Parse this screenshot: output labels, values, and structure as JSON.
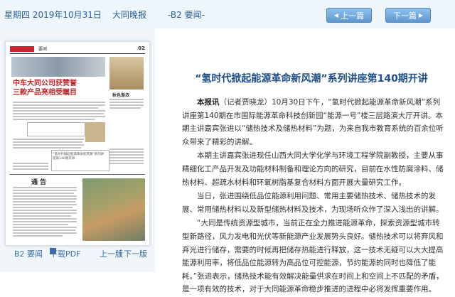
{
  "topbar": {
    "date": "星期四 2019年10月31日",
    "paper": "大同晚报",
    "page": "-B2 要闻-",
    "prev_label": "上一篇",
    "next_label": "下一篇"
  },
  "thumbnail": {
    "masthead_label": "要闻",
    "page_num": "02",
    "headline_line1": "中车大同公司获赞誉",
    "headline_line2": "三款产品亮相受瞩目",
    "notice_title": "通  告",
    "side_title": "秋色渐浓",
    "side_caption": "“氢时代掀起能源革命新风潮”系列讲座第140期开讲"
  },
  "bottom_links": {
    "page_label": "B2 要闻",
    "pdf_label": "下载PDF",
    "prev_page": "上一版",
    "separator": "|",
    "next_page": "下一版"
  },
  "article": {
    "title": "“氢时代掀起能源革命新风潮”系列讲座第140期开讲",
    "lead": "本报讯",
    "p1": "（记者贾晓龙）10月30日下午，“氢时代掀起能源革命新风潮”系列讲座第140期在市国际能源革命科技创新园“能源一号”楼三层路演大厅开讲。本期主讲嘉宾张进以“储热技术及储热材料”为题，为来自我市教育系统的百余位听众带来了精彩的讲解。",
    "p2": "本期主讲嘉宾张进现任山西大同大学化学与环境工程学院副教授，主要从事精细化工产品开发及功能材料制备和理论方向的研究，目前在水性防腐涂料、储热材料、超疏水材料和环氧树脂基复合材料方面开展大量研究工作。",
    "p3": "当日，张进围绕低品位能源利用问题、常用主要储热技术、储热技术的发展、常用储热材料以及新型储热材料及技术，为现场听众作了深入浅出的讲解。",
    "p4": "“大同是传统资源型城市，当前正在全力推进能源革命，探索资源型城市转型新路径，风力发电和光伏等新能源产业发展势头良好。储热技术可以将弃风和弃光进行储存，需要的时候再把储存热能进行释放，这一技术无疑可以大大提高能源利用率，将低品位能源转为高品位可控能源，节约能源的同时也降低了能耗。”张进表示，储热技术能有效解决能量供求在时间上和空间上不匹配的矛盾，是一项有效的技术，对于大同能源革命稳步推进的进程中必将发挥重要作用。"
  },
  "colors": {
    "accent": "#2b5f9a",
    "title": "#1f4f86",
    "masthead": "#c8262d"
  }
}
